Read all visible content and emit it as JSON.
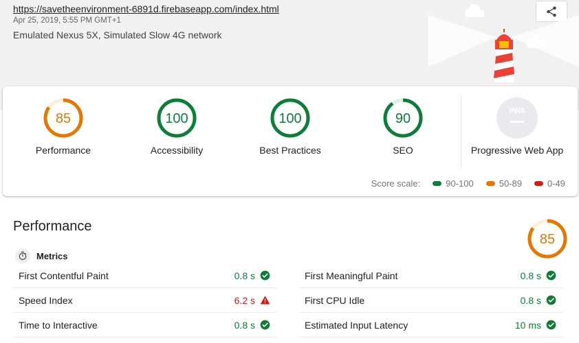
{
  "header": {
    "url": "https://savetheenvironment-6891d.firebaseapp.com/index.html",
    "date": "Apr 25, 2019, 5:55 PM GMT+1",
    "device": "Emulated Nexus 5X, Simulated Slow 4G network",
    "share_icon": "share-icon"
  },
  "summary": {
    "gauges": [
      {
        "label": "Performance",
        "score": "85",
        "value": 0.85,
        "color": "#e67700"
      },
      {
        "label": "Accessibility",
        "score": "100",
        "value": 1.0,
        "color": "#0c7e37"
      },
      {
        "label": "Best Practices",
        "score": "100",
        "value": 1.0,
        "color": "#0c7e37"
      },
      {
        "label": "SEO",
        "score": "90",
        "value": 0.9,
        "color": "#0c7e37"
      }
    ],
    "pwa": {
      "label": "Progressive Web App",
      "badge": "PWA"
    },
    "scale": {
      "label": "Score scale:",
      "ranges": [
        {
          "text": "90-100",
          "color": "#0c7e37"
        },
        {
          "text": "50-89",
          "color": "#e67700"
        },
        {
          "text": "0-49",
          "color": "#cc1f17"
        }
      ]
    }
  },
  "performance": {
    "title": "Performance",
    "score": "85",
    "value": 0.85,
    "metrics_label": "Metrics",
    "metrics_left": [
      {
        "name": "First Contentful Paint",
        "value": "0.8 s",
        "status": "pass"
      },
      {
        "name": "Speed Index",
        "value": "6.2 s",
        "status": "fail"
      },
      {
        "name": "Time to Interactive",
        "value": "0.8 s",
        "status": "pass"
      }
    ],
    "metrics_right": [
      {
        "name": "First Meaningful Paint",
        "value": "0.8 s",
        "status": "pass"
      },
      {
        "name": "First CPU Idle",
        "value": "0.8 s",
        "status": "pass"
      },
      {
        "name": "Estimated Input Latency",
        "value": "10 ms",
        "status": "pass"
      }
    ]
  },
  "colors": {
    "pass": "#0c7e37",
    "average": "#e67700",
    "fail": "#cc1f17"
  }
}
